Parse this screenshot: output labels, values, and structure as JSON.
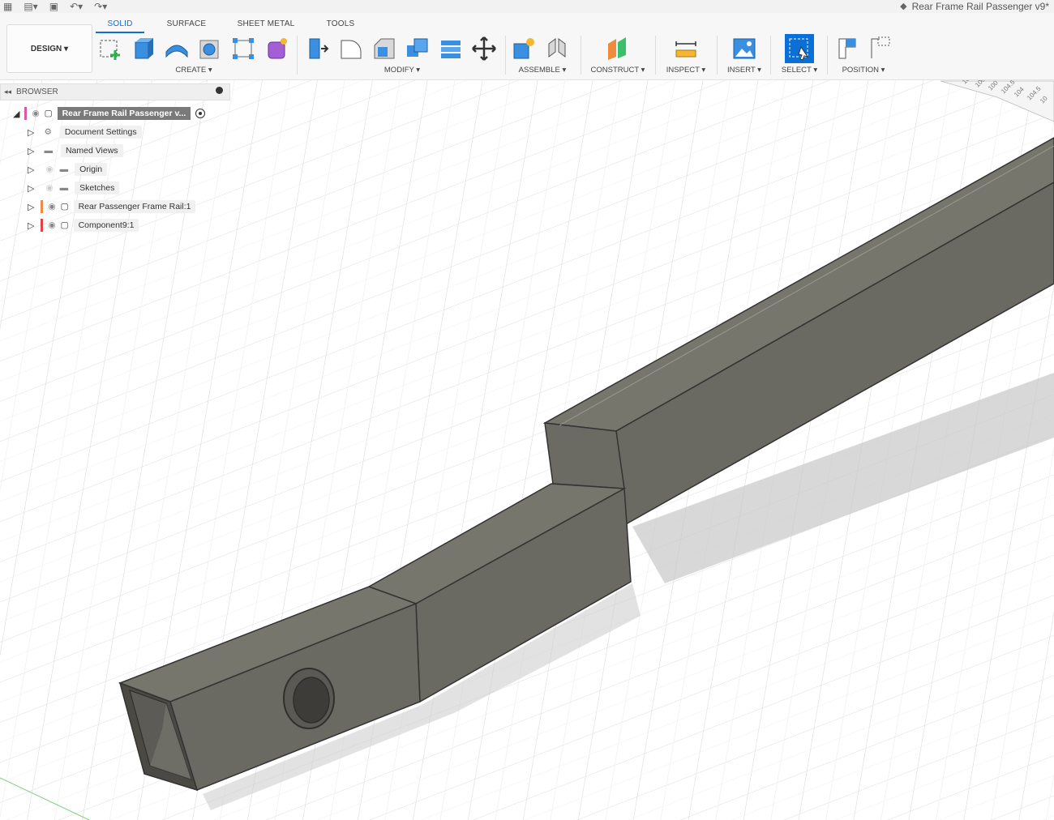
{
  "window": {
    "title": "Rear Frame Rail Passenger v9*"
  },
  "workspace": {
    "label": "DESIGN"
  },
  "tabs": [
    {
      "label": "SOLID",
      "active": true
    },
    {
      "label": "SURFACE",
      "active": false
    },
    {
      "label": "SHEET METAL",
      "active": false
    },
    {
      "label": "TOOLS",
      "active": false
    }
  ],
  "groups": {
    "create": "CREATE",
    "modify": "MODIFY",
    "assemble": "ASSEMBLE",
    "construct": "CONSTRUCT",
    "inspect": "INSPECT",
    "insert": "INSERT",
    "select": "SELECT",
    "position": "POSITION"
  },
  "browser": {
    "header": "BROWSER",
    "root": "Rear Frame Rail Passenger v...",
    "items": [
      {
        "label": "Document Settings",
        "icon": "gear-icon"
      },
      {
        "label": "Named Views",
        "icon": "folder-icon"
      },
      {
        "label": "Origin",
        "icon": "folder-icon"
      },
      {
        "label": "Sketches",
        "icon": "folder-icon"
      },
      {
        "label": "Rear Passenger Frame Rail:1",
        "icon": "component-icon",
        "color": "#f08a3c"
      },
      {
        "label": "Component9:1",
        "icon": "body-icon",
        "color": "#e04545"
      }
    ]
  },
  "viewcube": {
    "labels": [
      "100",
      "100.5",
      "100",
      "104.5",
      "104",
      "104.5",
      "10"
    ]
  },
  "colors": {
    "accent": "#0a6fd6",
    "model_top": "#77766d",
    "model_side": "#6a6962",
    "model_front": "#5f5e57"
  }
}
